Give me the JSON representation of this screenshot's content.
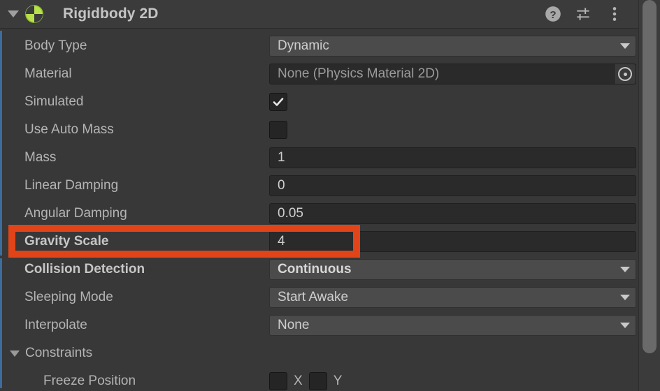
{
  "component": {
    "title": "Rigidbody 2D",
    "icon_name": "rigidbody2d-icon",
    "expanded": true,
    "accent_green": "#b7e04a",
    "help_icon": "help-icon",
    "preset_icon": "preset-sliders-icon",
    "menu_icon": "more-options-icon"
  },
  "annotation": {
    "color": "#e04418",
    "target_row": "Gravity Scale"
  },
  "properties": [
    {
      "label": "Body Type",
      "type": "popup",
      "value": "Dynamic",
      "bold": false
    },
    {
      "label": "Material",
      "type": "object",
      "value": "None (Physics Material 2D)",
      "bold": false
    },
    {
      "label": "Simulated",
      "type": "checkbox",
      "value": true,
      "bold": false
    },
    {
      "label": "Use Auto Mass",
      "type": "checkbox",
      "value": false,
      "bold": false
    },
    {
      "label": "Mass",
      "type": "number",
      "value": "1",
      "bold": false
    },
    {
      "label": "Linear Damping",
      "type": "number",
      "value": "0",
      "bold": false
    },
    {
      "label": "Angular Damping",
      "type": "number",
      "value": "0.05",
      "bold": false
    },
    {
      "label": "Gravity Scale",
      "type": "number",
      "value": "4",
      "bold": true
    },
    {
      "label": "Collision Detection",
      "type": "popup",
      "value": "Continuous",
      "bold": true
    },
    {
      "label": "Sleeping Mode",
      "type": "popup",
      "value": "Start Awake",
      "bold": false
    },
    {
      "label": "Interpolate",
      "type": "popup",
      "value": "None",
      "bold": false
    }
  ],
  "constraints": {
    "label": "Constraints",
    "expanded": true,
    "freeze_position": {
      "label": "Freeze Position",
      "axes": [
        {
          "axis": "X",
          "checked": false
        },
        {
          "axis": "Y",
          "checked": false
        }
      ]
    }
  }
}
